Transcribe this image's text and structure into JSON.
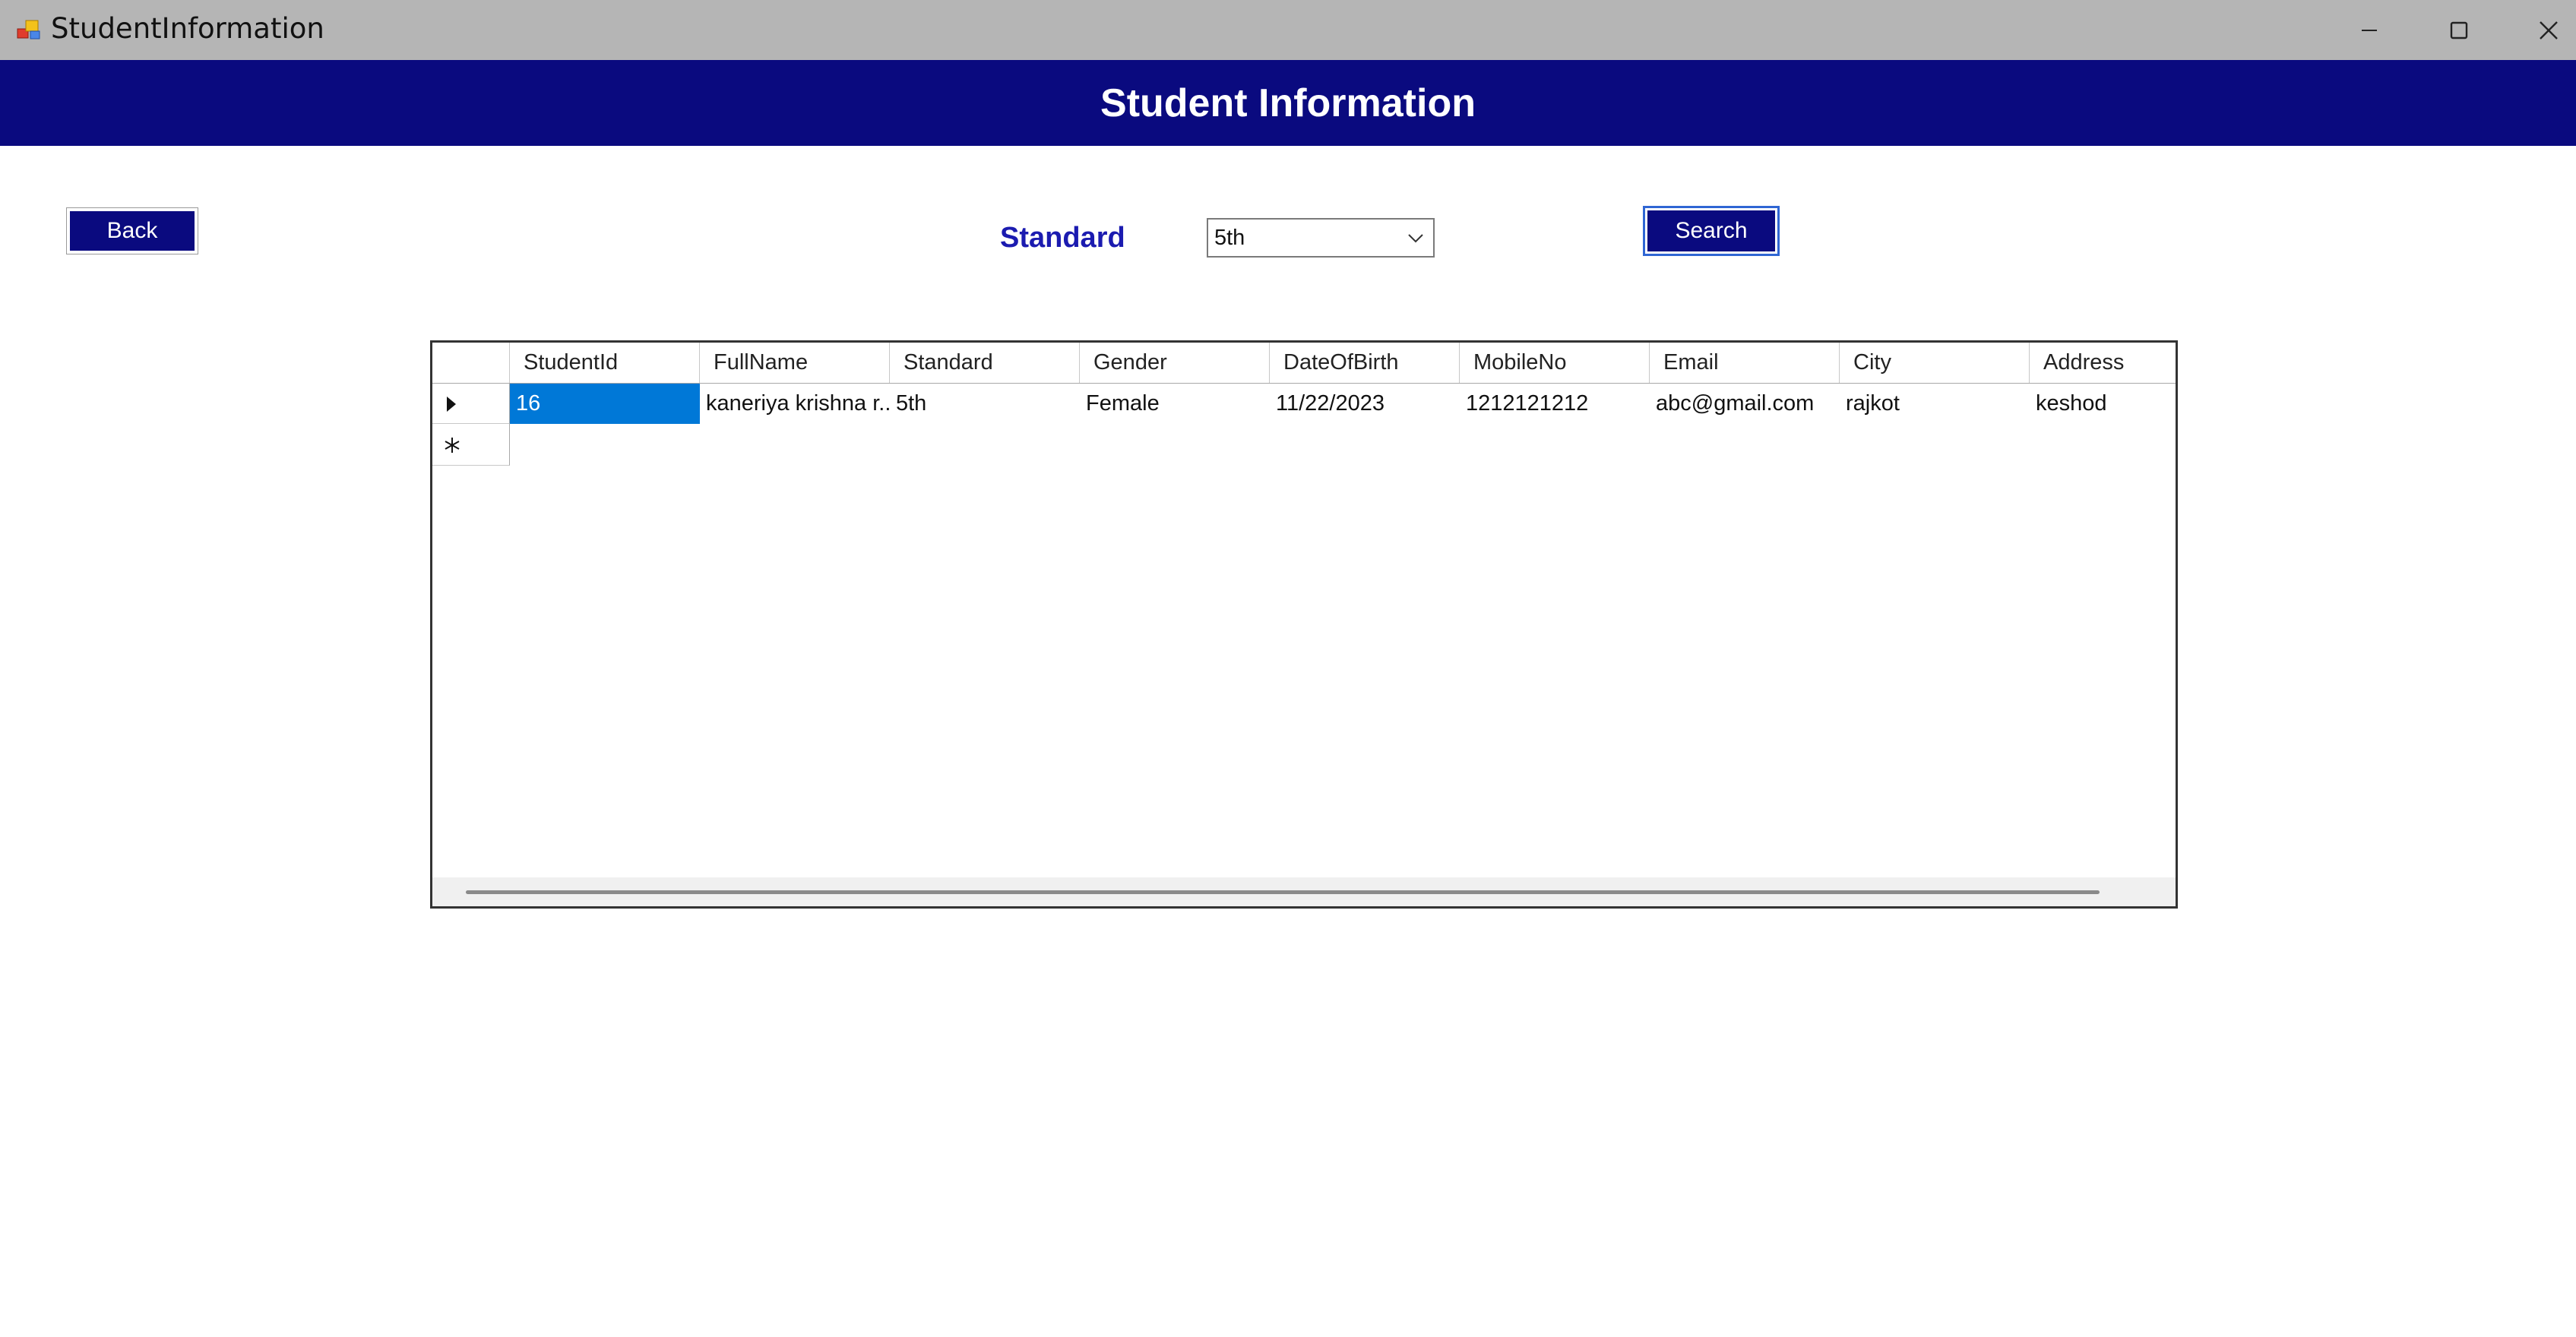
{
  "window": {
    "title": "StudentInformation",
    "minimize_icon": "minimize-icon",
    "maximize_icon": "maximize-icon",
    "close_icon": "close-icon"
  },
  "header": {
    "title": "Student Information",
    "background": "#0a0a7f"
  },
  "toolbar": {
    "back_label": "Back",
    "search_label": "Search",
    "standard_label": "Standard",
    "standard_selected": "5th"
  },
  "grid": {
    "columns": [
      "StudentId",
      "FullName",
      "Standard",
      "Gender",
      "DateOfBirth",
      "MobileNo",
      "Email",
      "City",
      "Address"
    ],
    "rows": [
      [
        "16",
        "kaneriya krishna r...",
        "5th",
        "Female",
        "11/22/2023",
        "1212121212",
        "abc@gmail.com",
        "rajkot",
        "keshod"
      ]
    ],
    "selected_cell_color": "#0078d7"
  }
}
